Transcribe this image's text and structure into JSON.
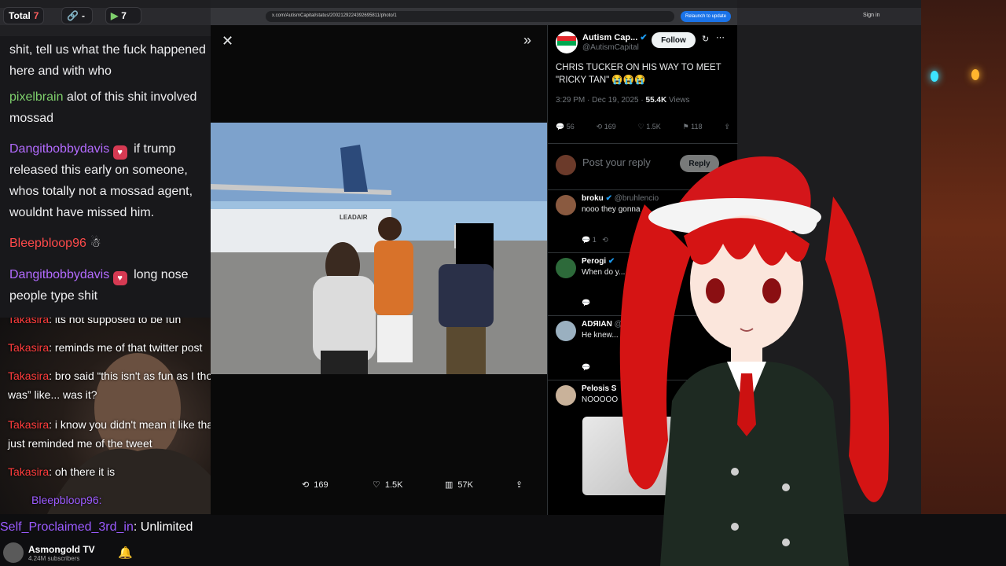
{
  "chrome": {
    "total_label": "Total",
    "total_count": "7",
    "links_count": "7",
    "tw_url": "x.com/AutismCapital/status/2002129224392695811/photo/1",
    "relaunch_label": "Relaunch to update",
    "signin_label": "Sign in"
  },
  "chat": {
    "messages": [
      {
        "text": "shit, tell us what the fuck happened here and with who"
      },
      {
        "user": "pixelbrain",
        "text": "alot of this shit involved mossad"
      },
      {
        "user": "Dangitbobbydavis",
        "text": "if trump released this early on someone, whos totally not a mossad agent, wouldnt have missed him."
      },
      {
        "user": "Bleepbloop96"
      },
      {
        "user": "Dangitbobbydavis",
        "text": "long nose people type shit"
      }
    ],
    "overlay": [
      {
        "user": "Takasira",
        "text": "its not supposed to be fun"
      },
      {
        "user": "Takasira",
        "text": "reminds me of that twitter post"
      },
      {
        "user": "Takasira",
        "text": "bro said “this isn't as fun as I thought it was” like... was it?"
      },
      {
        "user": "Takasira",
        "text": "i know you didn't mean it like that lol. it just reminded me of the tweet"
      },
      {
        "user": "Takasira",
        "text": "oh there it is"
      },
      {
        "user": "Bleepbloop96:"
      }
    ],
    "unlimited_user": "Self_Proclaimed_3rd_in",
    "unlimited_text": ": Unlimited",
    "channel_name": "Asmongold TV",
    "channel_subs": "4.24M subscribers"
  },
  "tweet": {
    "author_name": "Autism Cap...",
    "author_handle": "@AutismCapital",
    "follow_label": "Follow",
    "text": "CHRIS TUCKER ON HIS WAY TO MEET \"RICKY TAN\" 😭😭😭",
    "time": "3:29 PM · Dec 19, 2025 ·",
    "views_count": "55.4K",
    "views_label": "Views",
    "stats": {
      "replies": "56",
      "reposts": "169",
      "likes": "1.5K",
      "bookmarks": "118"
    },
    "reply_placeholder": "Post your reply",
    "reply_button": "Reply",
    "media_bar": {
      "reposts": "169",
      "likes": "1.5K",
      "views": "57K"
    },
    "photo_building_text": "LEADAIR"
  },
  "replies": [
    {
      "name": "broku",
      "handle": "@bruhlencio",
      "text": "nooo they gonna"
    },
    {
      "name": "Perogi",
      "handle": "",
      "text": "When do y... series on"
    },
    {
      "name": "ADЯIAN",
      "handle": "@adrian_...",
      "text": "He knew... he \"tur"
    },
    {
      "name": "Pelosis S",
      "handle": "",
      "text": "NOOOOO"
    }
  ],
  "colors": {
    "twitter_blue": "#1d9bf0",
    "chat_red": "#ff3c3c",
    "chat_purple": "#9b5bff",
    "chat_green": "#7ecf6c"
  }
}
